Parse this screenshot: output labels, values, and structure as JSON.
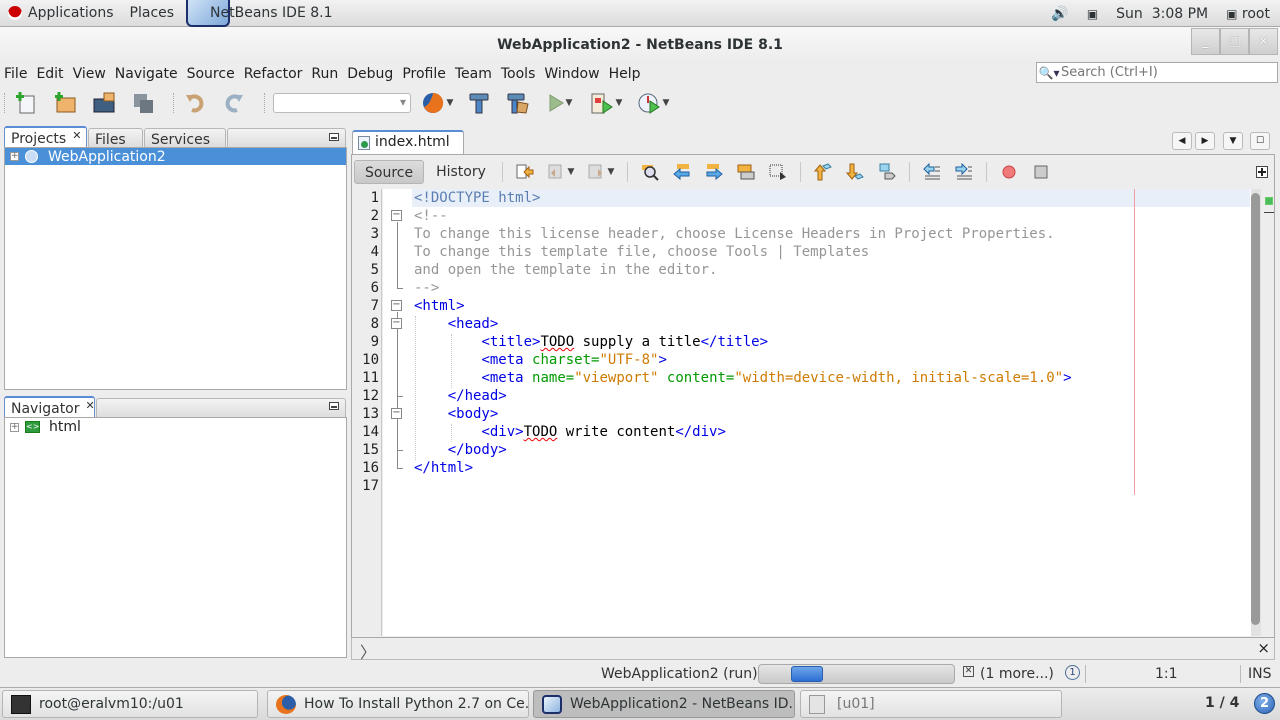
{
  "system_bar": {
    "applications": "Applications",
    "places": "Places",
    "active_app": "NetBeans IDE 8.1",
    "datetime": "Sun  3:08 PM",
    "user": "root"
  },
  "window": {
    "title": "WebApplication2 - NetBeans IDE 8.1",
    "minimize": "_",
    "maximize": "□",
    "close": "×"
  },
  "menu": [
    "File",
    "Edit",
    "View",
    "Navigate",
    "Source",
    "Refactor",
    "Run",
    "Debug",
    "Profile",
    "Team",
    "Tools",
    "Window",
    "Help"
  ],
  "search": {
    "placeholder": "Search (Ctrl+I)",
    "value": ""
  },
  "toolbar": {
    "icons": [
      "new-file-icon",
      "new-project-icon",
      "open-project-icon",
      "save-all-icon",
      "undo-icon",
      "redo-icon"
    ],
    "config_selected": "",
    "run_icons": [
      "firefox-browser-icon",
      "build-hammer-icon",
      "clean-build-icon",
      "run-icon",
      "debug-icon",
      "profile-icon"
    ]
  },
  "projects_panel": {
    "tabs": [
      {
        "label": "Projects",
        "active": true
      },
      {
        "label": "Files",
        "active": false
      },
      {
        "label": "Services",
        "active": false
      }
    ],
    "tree": [
      {
        "label": "WebApplication2",
        "selected": true
      }
    ]
  },
  "navigator_panel": {
    "tab": "Navigator",
    "tree": [
      {
        "label": "html"
      }
    ]
  },
  "editor": {
    "tab_label": "index.html",
    "close": "×",
    "modes": {
      "source": "Source",
      "history": "History",
      "active": "Source"
    },
    "line_numbers": [
      "1",
      "2",
      "3",
      "4",
      "5",
      "6",
      "7",
      "8",
      "9",
      "10",
      "11",
      "12",
      "13",
      "14",
      "15",
      "16",
      "17"
    ],
    "lines": [
      "<!DOCTYPE html>",
      "<!--",
      "To change this license header, choose License Headers in Project Properties.",
      "To change this template file, choose Tools | Templates",
      "and open the template in the editor.",
      "-->",
      "<html>",
      "    <head>",
      "        <title>TODO supply a title</title>",
      "        <meta charset=\"UTF-8\">",
      "        <meta name=\"viewport\" content=\"width=device-width, initial-scale=1.0\">",
      "    </head>",
      "    <body>",
      "        <div>TODO write content</div>",
      "    </body>",
      "</html>",
      ""
    ]
  },
  "output_bar": {
    "close": "×"
  },
  "status_bar": {
    "task": "WebApplication2 (run)",
    "more": "(1 more...)",
    "notifications": "1",
    "position": "1:1",
    "mode": "INS",
    "progress_indeterminate": true
  },
  "taskbar": {
    "items": [
      {
        "label": "root@eralvm10:/u01",
        "icon": "terminal-icon",
        "active": false
      },
      {
        "label": "How To Install Python 2.7 on Ce...",
        "icon": "firefox-icon",
        "active": false
      },
      {
        "label": "WebApplication2 - NetBeans ID...",
        "icon": "netbeans-icon",
        "active": true
      },
      {
        "label": "[u01]",
        "icon": "file-cabinet-icon",
        "active": false
      }
    ],
    "workspace": "1 / 4",
    "notification_count": "2"
  }
}
